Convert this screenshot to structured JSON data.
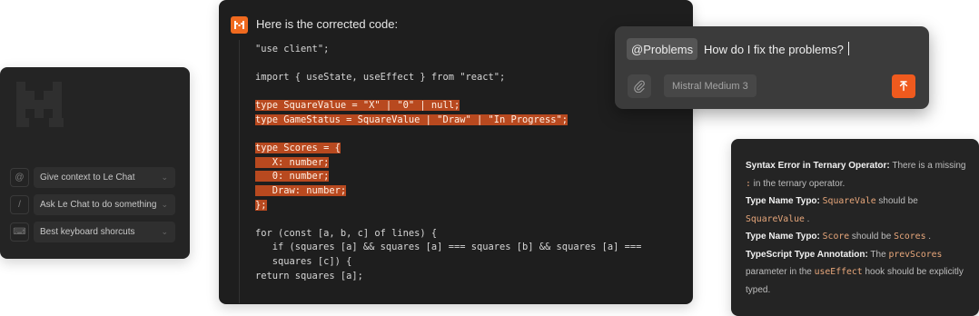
{
  "left_panel": {
    "items": [
      {
        "key": "@",
        "label": "Give context to Le Chat"
      },
      {
        "key": "/",
        "label": "Ask Le Chat to do something"
      },
      {
        "key": "⌨",
        "label": "Best keyboard shorcuts"
      }
    ]
  },
  "code_panel": {
    "heading": "Here is the corrected code:",
    "lines": [
      "\"use client\";",
      "",
      "import { useState, useEffect } from \"react\";",
      "",
      "type SquareValue = \"X\" | \"0\" | null;",
      "type GameStatus = SquareValue | \"Draw\" | \"In Progress\";",
      "",
      "type Scores = {",
      "   X: number;",
      "   0: number;",
      "   Draw: number;",
      "};",
      "",
      "for (const [a, b, c] of lines) {",
      "   if (squares [a] && squares [a] === squares [b] && squares [a] ===",
      "   squares [c]) {",
      "return squares [a];"
    ]
  },
  "chat": {
    "mention": "@Problems",
    "question": "How do I fix the problems?",
    "model": "Mistral Medium 3",
    "colors": {
      "send": "#ef5a1e",
      "accent": "#f06a1f"
    }
  },
  "errors": {
    "e1_title": "Syntax Error in Ternary Operator:",
    "e1_text": " There is a missing",
    "e1_code": ":",
    "e1_text2": " in the ternary operator.",
    "e2_title": "Type Name Typo:",
    "e2_code1": "SquareVale",
    "e2_text": " should be",
    "e2_code2": "SquareValue",
    "e2_end": " .",
    "e3_title": "Type Name Typo:",
    "e3_code1": "Score",
    "e3_text": " should be ",
    "e3_code2": "Scores",
    "e3_end": " .",
    "e4_title": "TypeScript Type Annotation:",
    "e4_text": " The ",
    "e4_code1": "prevScores",
    "e4_text2": "parameter in the ",
    "e4_code2": "useEffect",
    "e4_text3": "  hook should be explicitly typed."
  }
}
